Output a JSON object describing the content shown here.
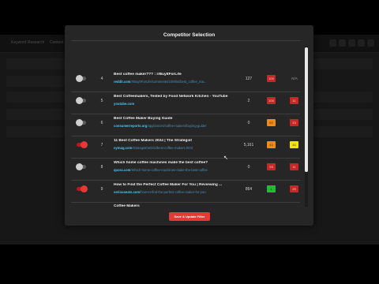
{
  "app": {
    "tabs": [
      "Keyword Research",
      "Content Outliner"
    ],
    "logo_main": "KW",
    "logo_accent": "Y"
  },
  "modal": {
    "title": "Competitor Selection",
    "save_label": "Save & Update Filter",
    "partial_next_title": "Coffee Makers"
  },
  "rows": [
    {
      "rank": "4",
      "enabled": false,
      "title": "Best coffee maker??? : r/BuyItForLife",
      "domain": "reddit.com",
      "path": "/r/BuyItForLife/comments/10r8lmi/best_coffee_ma...",
      "metric": "127",
      "badge1": "100",
      "badge1_color": "red",
      "badge2": "N/A",
      "badge2_color": "none"
    },
    {
      "rank": "5",
      "enabled": false,
      "title": "Best Coffeemakers, Tested by Food Network Kitchen - YouTube",
      "domain": "youtube.com",
      "path": "",
      "metric": "2",
      "badge1": "100",
      "badge1_color": "red",
      "badge2": "11",
      "badge2_color": "red"
    },
    {
      "rank": "6",
      "enabled": false,
      "title": "Best Coffee Maker Buying Guide",
      "domain": "consumerreports.org",
      "path": "/appliances/coffee-makers/buying-guide/",
      "metric": "0",
      "badge1": "53",
      "badge1_color": "orange",
      "badge2": "13",
      "badge2_color": "red"
    },
    {
      "rank": "7",
      "enabled": true,
      "title": "11 Best Coffee Makers 2024 | The Strategist",
      "domain": "nymag.com",
      "path": "/strategist/article/best-coffee-makers.html",
      "metric": "5,161",
      "badge1": "43",
      "badge1_color": "orange",
      "badge2": "46",
      "badge2_color": "yellow"
    },
    {
      "rank": "8",
      "enabled": false,
      "title": "Which home coffee machines make the best coffee?",
      "domain": "quora.com",
      "path": "/Which-home-coffee-machines-make-the-best-coffee",
      "metric": "0",
      "badge1": "93",
      "badge1_color": "red",
      "badge2": "11",
      "badge2_color": "red"
    },
    {
      "rank": "9",
      "enabled": true,
      "title": "How to Find the Perfect Coffee Maker For You | Reviewing ...",
      "domain": "seriouseats.com",
      "path": "/how-to-find-the-perfect-coffee-maker-for-you",
      "metric": "864",
      "badge1": "1",
      "badge1_color": "green",
      "badge2": "29",
      "badge2_color": "red"
    }
  ]
}
